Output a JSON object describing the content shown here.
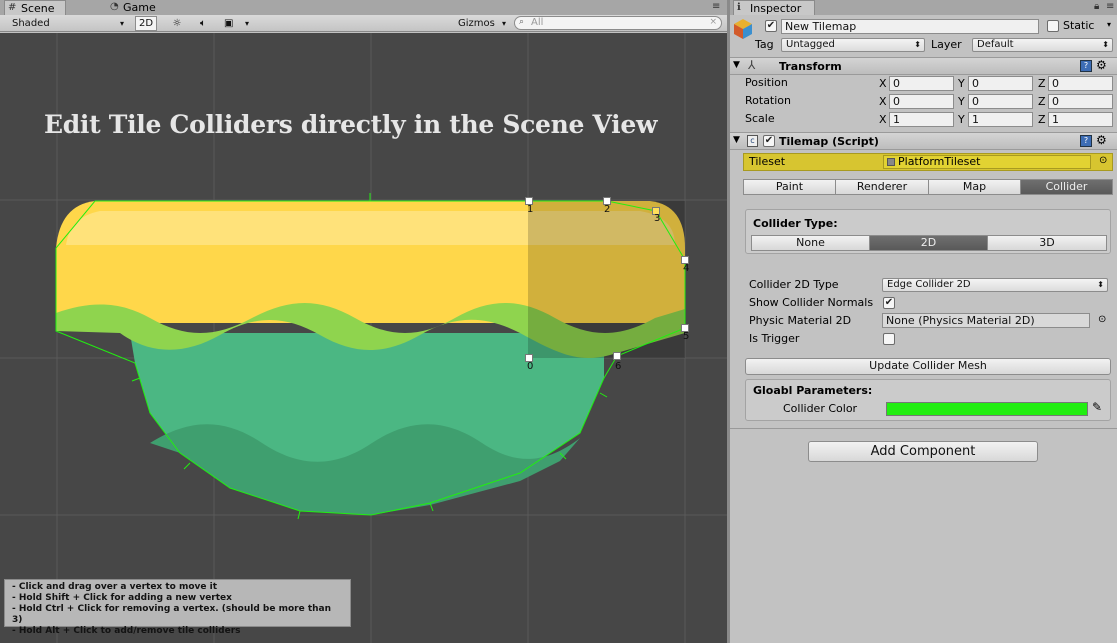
{
  "tabs": {
    "scene": "Scene",
    "game": "Game",
    "inspector": "Inspector"
  },
  "scene_toolbar": {
    "shading": "Shaded",
    "mode_2d": "2D",
    "gizmos": "Gizmos",
    "search_placeholder": "All"
  },
  "scene": {
    "caption": "Edit Tile Colliders directly in the Scene View",
    "vertex_labels": [
      "0",
      "1",
      "2",
      "3",
      "4",
      "5",
      "6"
    ],
    "help_lines": [
      "- Click and drag over a vertex to move it",
      "- Hold Shift + Click for adding a new vertex",
      "- Hold Ctrl + Click for removing a vertex. (should be more than 3)",
      "- Hold Alt + Click to add/remove tile colliders"
    ]
  },
  "inspector": {
    "object_name": "New Tilemap",
    "static_label": "Static",
    "tag_label": "Tag",
    "tag_value": "Untagged",
    "layer_label": "Layer",
    "layer_value": "Default",
    "transform": {
      "title": "Transform",
      "rows": [
        {
          "label": "Position",
          "x": "0",
          "y": "0",
          "z": "0"
        },
        {
          "label": "Rotation",
          "x": "0",
          "y": "0",
          "z": "0"
        },
        {
          "label": "Scale",
          "x": "1",
          "y": "1",
          "z": "1"
        }
      ],
      "axis_x": "X",
      "axis_y": "Y",
      "axis_z": "Z"
    },
    "tilemap": {
      "title": "Tilemap (Script)",
      "tileset_label": "Tileset",
      "tileset_value": "PlatformTileset",
      "tabs": [
        "Paint",
        "Renderer",
        "Map",
        "Collider"
      ],
      "active_tab": "Collider",
      "collider_type_label": "Collider Type:",
      "collider_types": [
        "None",
        "2D",
        "3D"
      ],
      "collider_active": "2D",
      "collider_2d_type_label": "Collider 2D Type",
      "collider_2d_type_value": "Edge Collider 2D",
      "show_normals_label": "Show Collider Normals",
      "show_normals": true,
      "physic_material_label": "Physic Material 2D",
      "physic_material_value": "None (Physics Material 2D)",
      "is_trigger_label": "Is Trigger",
      "is_trigger": false,
      "update_button": "Update Collider Mesh",
      "global_params_label": "Gloabl Parameters:",
      "collider_color_label": "Collider Color",
      "collider_color": "#22ee11"
    },
    "add_component": "Add Component"
  },
  "colors": {
    "scene_bg": "#474747",
    "tile_yellow": "#ffd74a",
    "tile_green": "#4bb783",
    "collider_line": "#22ee11"
  }
}
